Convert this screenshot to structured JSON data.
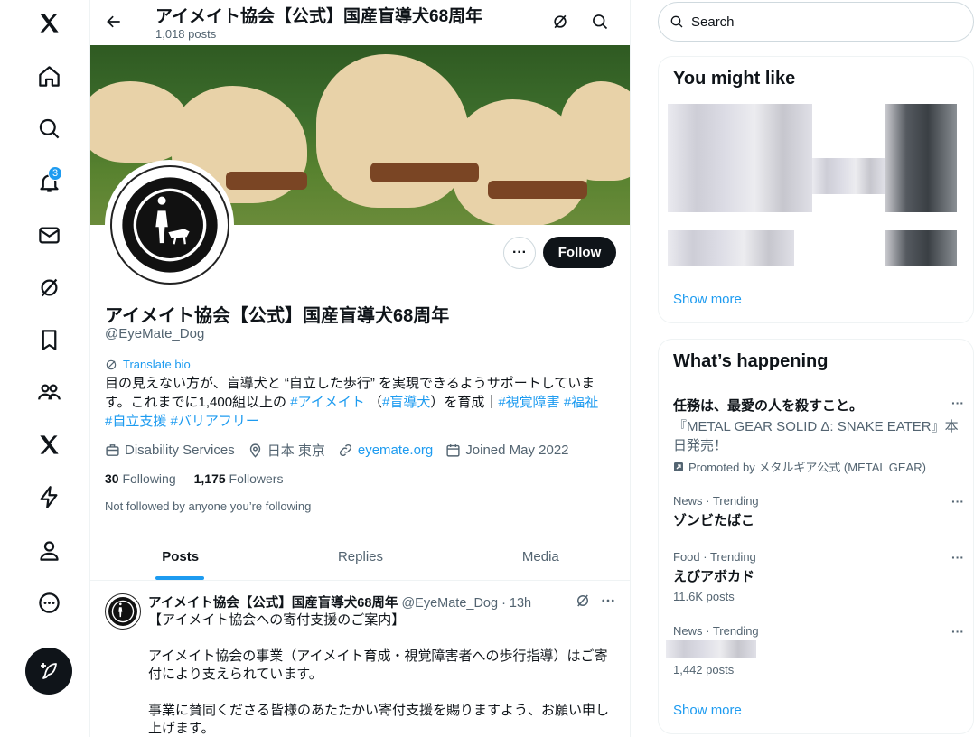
{
  "nav": {
    "notification_count": "3",
    "icons": [
      "x-logo-icon",
      "home-icon",
      "search-icon",
      "bell-icon",
      "mail-icon",
      "grok-icon",
      "bookmark-icon",
      "communities-icon",
      "x-premium-icon",
      "lightning-icon",
      "profile-icon",
      "more-circle-icon"
    ]
  },
  "header": {
    "title": "アイメイト協会【公式】国産盲導犬68周年",
    "posts_count": "1,018 posts"
  },
  "profile": {
    "display_name": "アイメイト協会【公式】国産盲導犬68周年",
    "handle": "@EyeMate_Dog",
    "translate_label": "Translate bio",
    "bio_line1": "目の見えない方が、盲導犬と “自立した歩行” を実現できるようサポートしていま",
    "bio_line2_a": "す。これまでに1,400組以上の ",
    "bio_tag1": "#アイメイト",
    "bio_line2_b": " （",
    "bio_tag2": "#盲導犬",
    "bio_line2_c": "）を育成｜",
    "bio_tag3": "#視覚障害",
    "bio_tag4": "#福祉",
    "bio_tag5": "#自立支援",
    "bio_tag6": "#バリアフリー",
    "category": "Disability Services",
    "location": "日本 東京",
    "website": "eyemate.org",
    "joined": "Joined May 2022",
    "following_count": "30",
    "following_label": "Following",
    "followers_count": "1,175",
    "followers_label": "Followers",
    "not_followed": "Not followed by anyone you’re following",
    "follow_label": "Follow",
    "more_label": "···"
  },
  "tabs": [
    "Posts",
    "Replies",
    "Media"
  ],
  "tweet": {
    "author": "アイメイト協会【公式】国産盲導犬68周年",
    "handle_time": "@EyeMate_Dog · 13h",
    "body": "【アイメイト協会への寄付支援のご案内】\n\nアイメイト協会の事業（アイメイト育成・視覚障害者への歩行指導）はご寄付により支えられています。\n\n事業に賛同くださる皆様のあたたかい寄付支援を賜りますよう、お願い申し上げます。"
  },
  "search": {
    "placeholder": "Search"
  },
  "you_might_like": {
    "title": "You might like",
    "show_more": "Show more"
  },
  "whats_happening": {
    "title": "What’s happening",
    "promo_title": "任務は、最愛の人を殺すこと。",
    "promo_desc": "『METAL GEAR SOLID Δ: SNAKE EATER』本日発売！",
    "promo_by": "Promoted by メタルギア公式 (METAL GEAR)",
    "trends": [
      {
        "category": "News · Trending",
        "name": "ゾンビたばこ",
        "posts": ""
      },
      {
        "category": "Food · Trending",
        "name": "えびアボカド",
        "posts": "11.6K posts"
      },
      {
        "category": "News · Trending",
        "name": "",
        "posts": "1,442 posts"
      }
    ],
    "show_more": "Show more"
  },
  "colors": {
    "accent": "#1d9bf0",
    "text": "#0f1419",
    "muted": "#536471",
    "border": "#eff3f4"
  }
}
